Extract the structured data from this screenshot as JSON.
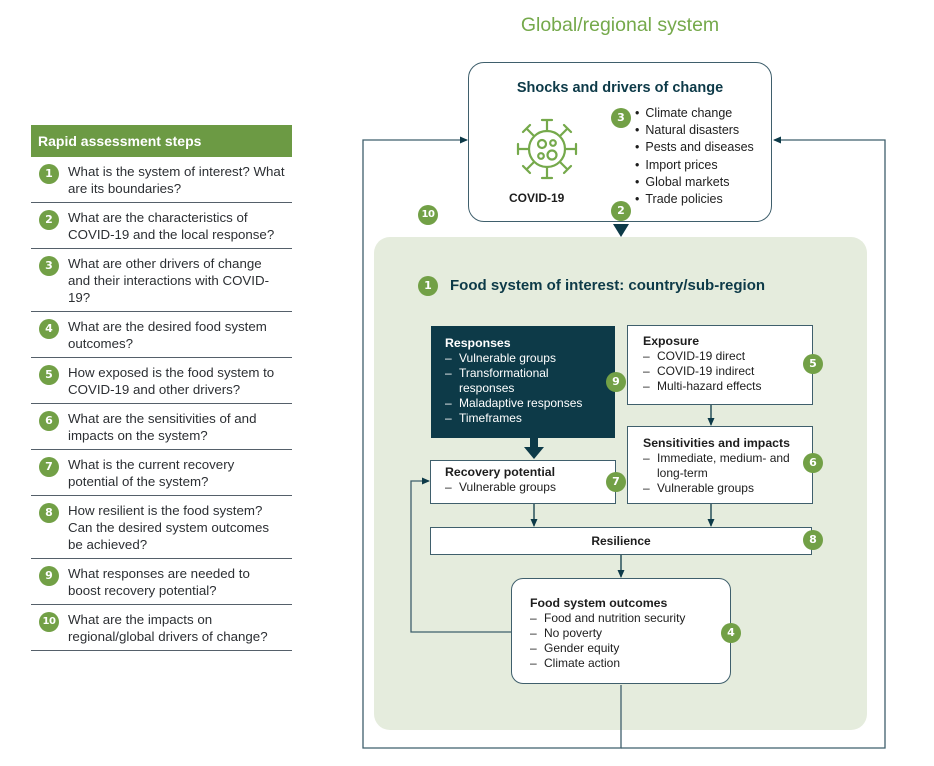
{
  "steps_panel": {
    "header": "Rapid assessment steps",
    "items": [
      {
        "num": "1",
        "text": "What is the system of interest? What are its boundaries?"
      },
      {
        "num": "2",
        "text": "What are the characteristics of COVID-19 and the local response?"
      },
      {
        "num": "3",
        "text": "What are other drivers of change and their interactions with COVID-19?"
      },
      {
        "num": "4",
        "text": "What are the desired food system outcomes?"
      },
      {
        "num": "5",
        "text": "How exposed is the food system to COVID-19 and other drivers?"
      },
      {
        "num": "6",
        "text": "What are the sensitivities of and impacts on the system?"
      },
      {
        "num": "7",
        "text": "What is the current recovery potential of the system?"
      },
      {
        "num": "8",
        "text": "How resilient is the food system? Can the desired system outcomes be achieved?"
      },
      {
        "num": "9",
        "text": "What responses are needed to boost recovery potential?"
      },
      {
        "num": "10",
        "text": "What are the impacts on regional/global drivers of change?"
      }
    ]
  },
  "diagram": {
    "title": "Global/regional system",
    "shocks": {
      "title": "Shocks and drivers of change",
      "covid_label": "COVID-19",
      "covid_icon": "virus-icon",
      "covid_badge": "2",
      "drivers_badge": "3",
      "drivers": [
        "Climate change",
        "Natural disasters",
        "Pests and diseases",
        "Import prices",
        "Global markets",
        "Trade policies"
      ]
    },
    "feedback_badge": "10",
    "food_system": {
      "badge": "1",
      "title": "Food system of interest: country/sub-region"
    },
    "responses": {
      "title": "Responses",
      "badge": "9",
      "items": [
        "Vulnerable groups",
        "Transformational responses",
        "Maladaptive responses",
        "Timeframes"
      ]
    },
    "exposure": {
      "title": "Exposure",
      "badge": "5",
      "items": [
        "COVID-19 direct",
        "COVID-19 indirect",
        "Multi-hazard effects"
      ]
    },
    "sensitivities": {
      "title": "Sensitivities and impacts",
      "badge": "6",
      "items": [
        "Immediate, medium- and long-term",
        "Vulnerable groups"
      ]
    },
    "recovery": {
      "title": "Recovery potential",
      "badge": "7",
      "items": [
        "Vulnerable groups"
      ]
    },
    "resilience": {
      "title": "Resilience",
      "badge": "8"
    },
    "outcomes": {
      "title": "Food system outcomes",
      "badge": "4",
      "items": [
        "Food and nutrition security",
        "No poverty",
        "Gender equity",
        "Climate action"
      ]
    }
  },
  "colors": {
    "accent_green": "#72a046",
    "header_green": "#6c9a44",
    "title_green": "#75a94b",
    "navy": "#0d3a48",
    "line": "#3f5f6c",
    "panel_bg": "#e5ecdd"
  }
}
